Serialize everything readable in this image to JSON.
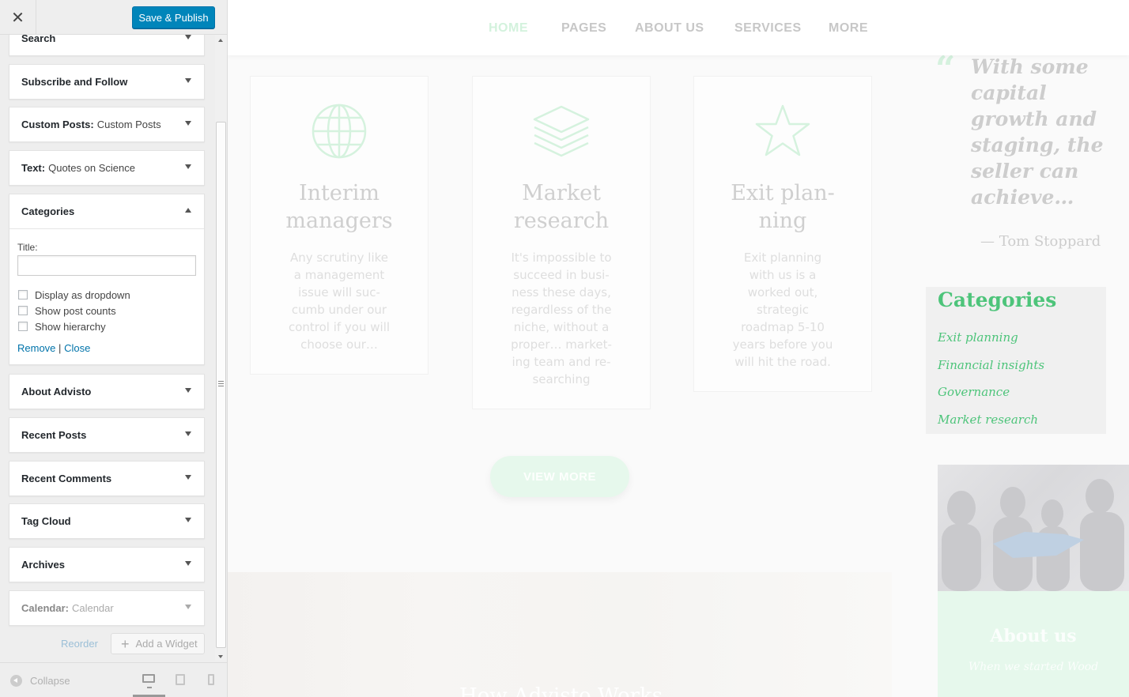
{
  "header": {
    "close_icon_glyph": "✕",
    "publish_label": "Save & Publish"
  },
  "widgets": [
    {
      "title": "Search",
      "subtitle": "",
      "state": "collapsed"
    },
    {
      "title": "Subscribe and Follow",
      "subtitle": "",
      "state": "collapsed"
    },
    {
      "title": "Custom Posts:",
      "subtitle": "Custom Posts",
      "state": "collapsed"
    },
    {
      "title": "Text:",
      "subtitle": "Quotes on Science",
      "state": "collapsed"
    },
    {
      "title": "Categories",
      "subtitle": "",
      "state": "expanded"
    },
    {
      "title": "About Advisto",
      "subtitle": "",
      "state": "collapsed"
    },
    {
      "title": "Recent Posts",
      "subtitle": "",
      "state": "collapsed"
    },
    {
      "title": "Recent Comments",
      "subtitle": "",
      "state": "collapsed"
    },
    {
      "title": "Tag Cloud",
      "subtitle": "",
      "state": "collapsed"
    },
    {
      "title": "Archives",
      "subtitle": "",
      "state": "collapsed"
    },
    {
      "title": "Calendar:",
      "subtitle": "Calendar",
      "state": "collapsed"
    }
  ],
  "categories_form": {
    "title_label": "Title:",
    "title_value": "",
    "options": [
      {
        "label": "Display as dropdown",
        "checked": false
      },
      {
        "label": "Show post counts",
        "checked": false
      },
      {
        "label": "Show hierarchy",
        "checked": false
      }
    ],
    "remove_label": "Remove",
    "separator": "|",
    "close_label": "Close"
  },
  "sidebar_actions": {
    "reorder_label": "Reorder",
    "add_widget_label": "Add a Widget"
  },
  "footer": {
    "collapse_label": "Collapse",
    "devices": [
      "desktop-icon",
      "tablet-icon",
      "mobile-icon"
    ]
  },
  "preview": {
    "nav": [
      {
        "label": "HOME",
        "active": true
      },
      {
        "label": "PAGES",
        "active": false
      },
      {
        "label": "ABOUT US",
        "active": false
      },
      {
        "label": "SERVICES",
        "active": false
      },
      {
        "label": "MORE",
        "active": false
      }
    ],
    "services": [
      {
        "icon": "globe-icon",
        "title_line1": "Interim",
        "title_line2": "managers",
        "text_lines": [
          "Any scrutiny like",
          "a management",
          "issue will suc-",
          "cumb under our",
          "control if you will",
          "choose our…"
        ]
      },
      {
        "icon": "layers-icon",
        "title_line1": "Market",
        "title_line2": "research",
        "text_lines": [
          "It's impossible to",
          "succeed in busi-",
          "ness these days,",
          "regardless of the",
          "niche, without a",
          "proper… market-",
          "ing team and re-",
          "searching"
        ]
      },
      {
        "icon": "star-icon",
        "title_line1": "Exit plan-",
        "title_line2": "ning",
        "text_lines": [
          "Exit planning",
          "with us is a",
          "worked out,",
          "strategic",
          "roadmap 5-10",
          "years before you",
          "will hit the road."
        ]
      }
    ],
    "view_more_label": "VIEW MORE",
    "quote": {
      "mark": "“",
      "lines": [
        "With some",
        "capital",
        "growth and",
        "staging, the",
        "seller can",
        "achieve…"
      ],
      "author": "— Tom Stoppard"
    },
    "categories": {
      "title": "Categories",
      "items": [
        "Exit planning",
        "Financial insights",
        "Governance",
        "Market research"
      ]
    },
    "about_title": "About us",
    "about_text": "When we started Wood",
    "hero_heading": "How Advisto Works",
    "colors": {
      "accent": "#4dc47a",
      "publish": "#0085ba",
      "link": "#0073aa"
    }
  }
}
